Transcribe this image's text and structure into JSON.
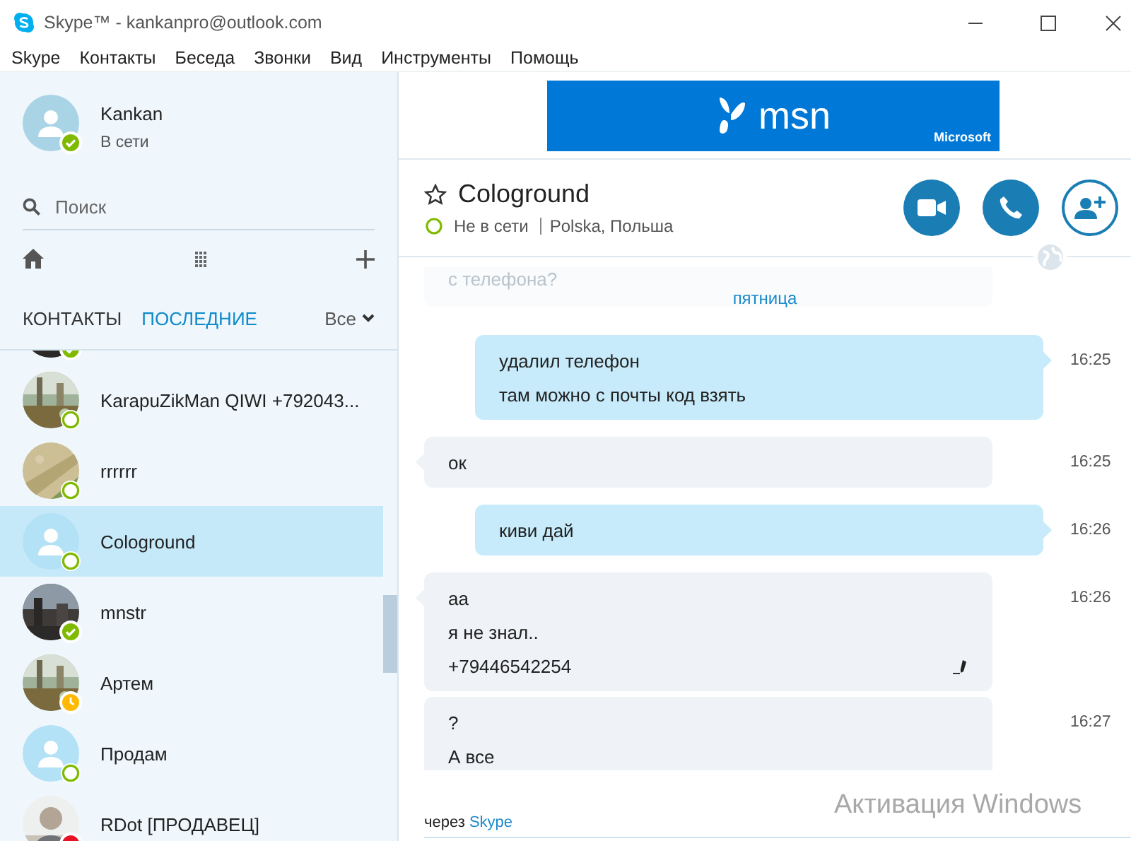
{
  "window": {
    "title": "Skype™ - kankanpro@outlook.com"
  },
  "menu": [
    "Skype",
    "Контакты",
    "Беседа",
    "Звонки",
    "Вид",
    "Инструменты",
    "Помощь"
  ],
  "profile": {
    "name": "Kankan",
    "status_text": "В сети",
    "status": {
      "kind": "online",
      "color": "#7fba00"
    }
  },
  "search": {
    "placeholder": "Поиск"
  },
  "tabs": [
    {
      "label": "КОНТАКТЫ",
      "selected": false
    },
    {
      "label": "ПОСЛЕДНИЕ",
      "selected": true
    }
  ],
  "filter": {
    "label": "Все"
  },
  "contacts": [
    {
      "status": {
        "kind": "online",
        "color": "#7fba00"
      },
      "selected": false
    },
    {
      "name": "KarapuZikMan QIWI +792043...",
      "status": {
        "kind": "offline",
        "color": "#7fba00"
      },
      "selected": false
    },
    {
      "name": "rrrrrr",
      "status": {
        "kind": "offline",
        "color": "#7fba00"
      },
      "selected": false
    },
    {
      "name": "Cologround",
      "avatar": {
        "kind": "default"
      },
      "status": {
        "kind": "offline",
        "color": "#7fba00"
      },
      "selected": true
    },
    {
      "name": "mnstr",
      "status": {
        "kind": "online",
        "color": "#7fba00"
      },
      "selected": false
    },
    {
      "name": "Артем",
      "status": {
        "kind": "away",
        "color": "#ffb900"
      },
      "selected": false
    },
    {
      "name": "Продам",
      "avatar": {
        "kind": "default"
      },
      "status": {
        "kind": "offline",
        "color": "#7fba00"
      },
      "selected": false
    },
    {
      "name": "RDot [ПРОДАВЕЦ]",
      "status": {
        "kind": "busy",
        "color": "#e81123"
      },
      "selected": false
    }
  ],
  "ad": {
    "brand": "msn",
    "company": "Microsoft"
  },
  "chat": {
    "title": "Cologround",
    "status": {
      "kind": "offline",
      "color": "#7fba00"
    },
    "status_text": "Не в сети",
    "location": "Polska, Польша"
  },
  "history": {
    "faded_text": "с телефона?",
    "date": "пятница"
  },
  "messages": [
    {
      "kind": "outgoing",
      "lines": [
        "удалил телефон",
        "там можно с почты код взять"
      ],
      "time": "16:25",
      "edited": false
    },
    {
      "kind": "incoming",
      "lines": [
        "ок"
      ],
      "time": "16:25",
      "edited": false
    },
    {
      "kind": "outgoing",
      "lines": [
        "киви дай"
      ],
      "time": "16:26",
      "edited": false
    },
    {
      "kind": "incoming",
      "lines": [
        "аа",
        "я не знал..",
        "+79446542254"
      ],
      "time": "16:26",
      "edited": true
    },
    {
      "kind": "incoming",
      "lines": [
        "?",
        "А все"
      ],
      "time": "16:27",
      "edited": false
    }
  ],
  "footer": {
    "text": "через",
    "link": "Skype"
  },
  "os_notice": {
    "title": "Активация Windows"
  }
}
